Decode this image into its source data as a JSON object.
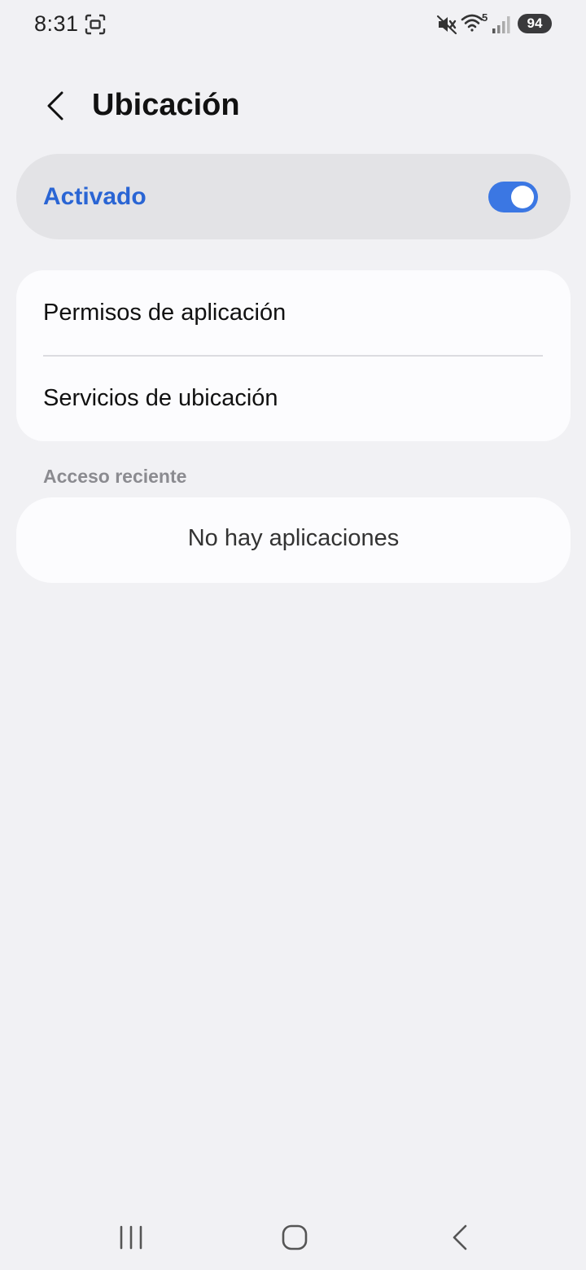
{
  "status_bar": {
    "time": "8:31",
    "wifi_badge": "5",
    "battery": "94",
    "icons": [
      "screenshot-icon",
      "mute-icon",
      "wifi-icon",
      "signal-icon",
      "battery-icon"
    ]
  },
  "header": {
    "title": "Ubicación",
    "back_icon": "chevron-left-icon"
  },
  "master_switch": {
    "label": "Activado",
    "state": "on",
    "accent_color": "#3b77e3",
    "label_color": "#2a65d4"
  },
  "settings_list": {
    "items": [
      {
        "label": "Permisos de aplicación"
      },
      {
        "label": "Servicios de ubicación"
      }
    ]
  },
  "recent_access": {
    "header": "Acceso reciente",
    "empty_text": "No hay aplicaciones"
  },
  "nav_bar": {
    "buttons": [
      "recents-icon",
      "home-icon",
      "back-icon"
    ]
  }
}
